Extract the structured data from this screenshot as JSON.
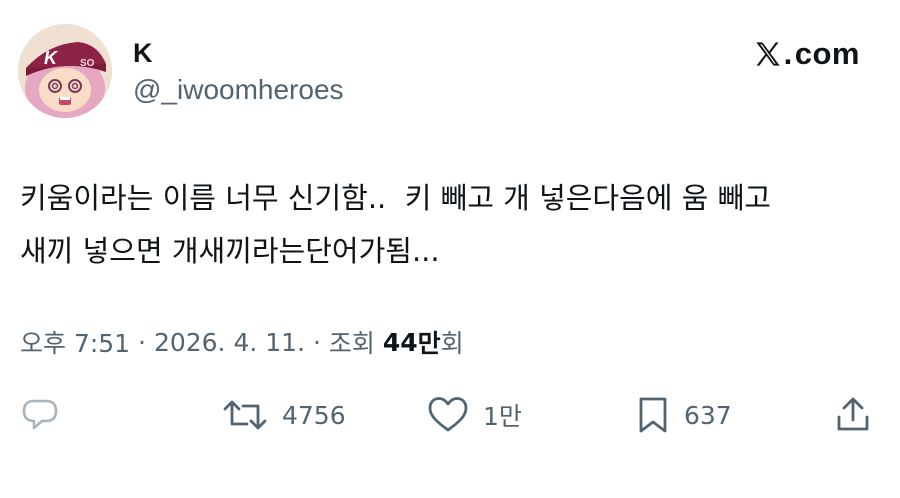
{
  "author": {
    "display_name": "K",
    "handle": "@_iwoomheroes"
  },
  "brand": {
    "logo_text": "com",
    "logo_icon": "x-logo-icon"
  },
  "tweet": {
    "text_line1": "키움이라는 이름 너무 신기함..  키 빼고 개 넣은다음에 움 빼고",
    "text_line2": "새끼 넣으면 개새끼라는단어가됨..."
  },
  "meta": {
    "time": "오후 7:51",
    "date": "2026. 4. 11.",
    "sep1": " · ",
    "sep2": " · ",
    "views_label": "조회",
    "views_count": "44",
    "views_unit": "만",
    "views_suffix": "회"
  },
  "actions": {
    "reply_count": "",
    "retweet_count": "4756",
    "like_count": "1만",
    "bookmark_count": "637"
  },
  "colors": {
    "text_primary": "#0f1419",
    "text_secondary": "#536471"
  }
}
